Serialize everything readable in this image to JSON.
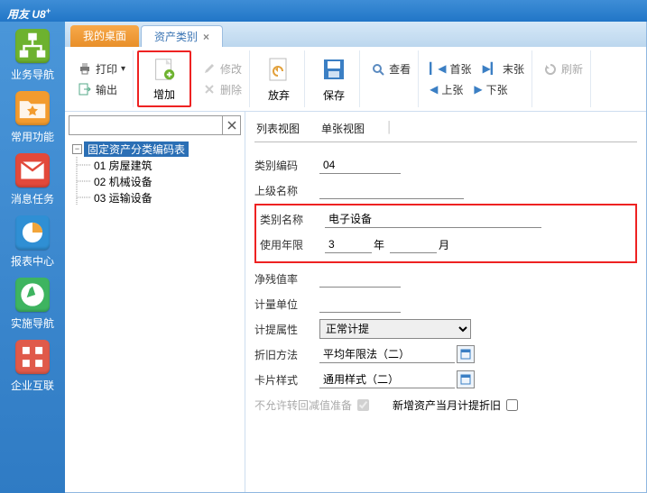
{
  "app": {
    "title_prefix": "用友",
    "title_brand": "U8",
    "title_sup": "+"
  },
  "nav": [
    {
      "label": "业务导航",
      "color": "#6db22f"
    },
    {
      "label": "常用功能",
      "color": "#f29b2e"
    },
    {
      "label": "消息任务",
      "color": "#e2493b"
    },
    {
      "label": "报表中心",
      "color": "#2f8fd4"
    },
    {
      "label": "实施导航",
      "color": "#3eb460"
    },
    {
      "label": "企业互联",
      "color": "#e05a4a"
    }
  ],
  "tabs": {
    "inactive": "我的桌面",
    "active": "资产类别"
  },
  "toolbar": {
    "print": "打印",
    "output": "输出",
    "add": "增加",
    "modify": "修改",
    "delete": "删除",
    "abandon": "放弃",
    "save": "保存",
    "view": "查看",
    "first": "首张",
    "last": "末张",
    "prev": "上张",
    "next": "下张",
    "refresh": "刷新"
  },
  "tree": {
    "root": "固定资产分类编码表",
    "children": [
      {
        "code": "01",
        "name": "房屋建筑"
      },
      {
        "code": "02",
        "name": "机械设备"
      },
      {
        "code": "03",
        "name": "运输设备"
      }
    ]
  },
  "viewtabs": {
    "list": "列表视图",
    "single": "单张视图"
  },
  "form": {
    "category_code_label": "类别编码",
    "category_code_value": "04",
    "parent_name_label": "上级名称",
    "parent_name_value": "",
    "category_name_label": "类别名称",
    "category_name_value": "电子设备",
    "useful_life_label": "使用年限",
    "useful_life_years": "3",
    "year_unit": "年",
    "useful_life_months": "",
    "month_unit": "月",
    "residual_rate_label": "净残值率",
    "residual_rate_value": "",
    "unit_label": "计量单位",
    "unit_value": "",
    "accrual_attr_label": "计提属性",
    "accrual_attr_value": "正常计提",
    "deprec_method_label": "折旧方法",
    "deprec_method_value": "平均年限法（二）",
    "card_style_label": "卡片样式",
    "card_style_value": "通用样式（二）",
    "no_reverse_label": "不允许转回减值准备",
    "no_reverse_checked": true,
    "new_month_deprec_label": "新增资产当月计提折旧",
    "new_month_deprec_checked": false
  }
}
